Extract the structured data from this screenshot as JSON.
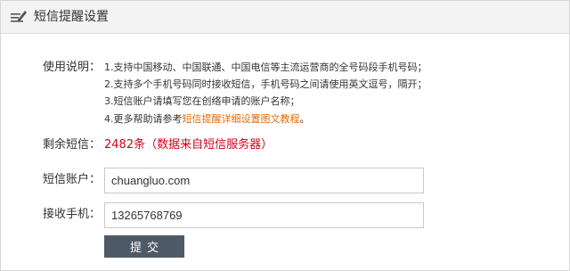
{
  "header": {
    "icon": "pencil-note-icon",
    "title": "短信提醒设置"
  },
  "usage": {
    "label": "使用说明：",
    "lines": [
      "1.支持中国移动、中国联通、中国电信等主流运营商的全号码段手机号码；",
      "2.支持多个手机号码同时接收短信，手机号码之间请使用英文逗号，隔开；",
      "3.短信账户请填写您在创络申请的账户名称；"
    ],
    "line4_prefix": "4.更多帮助请参考",
    "line4_link": "短信提醒详细设置图文教程",
    "line4_suffix": "。"
  },
  "remaining": {
    "label": "剩余短信：",
    "value": "2482条（数据来自短信服务器）"
  },
  "account": {
    "label": "短信账户：",
    "value": "chuangluo.com"
  },
  "phone": {
    "label": "接收手机：",
    "value": "13265768769"
  },
  "submit": {
    "label": "提交"
  },
  "colors": {
    "link": "#e36c09",
    "remaining": "#d0021b",
    "button": "#4f5a68"
  }
}
